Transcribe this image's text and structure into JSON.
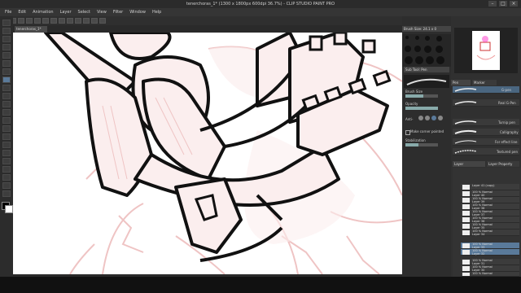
{
  "window": {
    "title": "tenerchoras_1* (1300 x 1800px 600dpi 36.7%)  - CLIP STUDIO PAINT PRO",
    "controls": [
      "–",
      "□",
      "×"
    ]
  },
  "menu": [
    "File",
    "Edit",
    "Animation",
    "Layer",
    "Select",
    "View",
    "Filter",
    "Window",
    "Help"
  ],
  "canvas_tab": "tenerchoras_1*",
  "panels": {
    "navigator_tab": "Brush Size: 24.1 x 0",
    "tool_property_tab": "Sub Tool: Pen",
    "brush_name": "Round pen",
    "properties": [
      {
        "label": "Brush Size",
        "value": "",
        "level": 0.55
      },
      {
        "label": "Opacity",
        "value": "",
        "level": 1.0
      },
      {
        "label": "Anti-",
        "value": "",
        "level": 0.5
      },
      {
        "label": "Make corner pointed",
        "value": "",
        "level": 0
      },
      {
        "label": "Stabilization",
        "value": "",
        "level": 0.4
      }
    ],
    "subtool_tabs": [
      "Pen",
      "Marker"
    ],
    "subtools": [
      "G-pen",
      "Real G-Pen",
      "Turnip pen",
      "Calligraphy",
      "For effect line",
      "Textured pen"
    ],
    "layer_tabs": [
      "Layer",
      "Layer Property"
    ]
  },
  "layers": [
    {
      "mode": "Layer 41 (copy)",
      "name": ""
    },
    {
      "mode": "100 % Normal",
      "name": "Layer 40"
    },
    {
      "mode": "100 % Normal",
      "name": "Layer 39"
    },
    {
      "mode": "100 % Normal",
      "name": "Layer 38"
    },
    {
      "mode": "100 % Normal",
      "name": "Layer 37"
    },
    {
      "mode": "100 % Normal",
      "name": "Layer 36"
    },
    {
      "mode": "100 % Normal",
      "name": "Layer 35"
    },
    {
      "mode": "100 % Normal",
      "name": "Layer 34"
    },
    {
      "mode": "100 % Normal",
      "name": "Layer 33"
    },
    {
      "mode": "100 % Normal",
      "name": "Layer 32"
    },
    {
      "mode": "100 % Normal",
      "name": "Layer 31"
    },
    {
      "mode": "100 % Normal",
      "name": "Layer 30"
    },
    {
      "mode": "100 % Normal",
      "name": "Layer 29"
    }
  ],
  "colors": {
    "sketch_pink": "#efc4c4",
    "ink": "#111111",
    "fill": "#fbeeee",
    "selected_layer": "#5a7a9a"
  }
}
